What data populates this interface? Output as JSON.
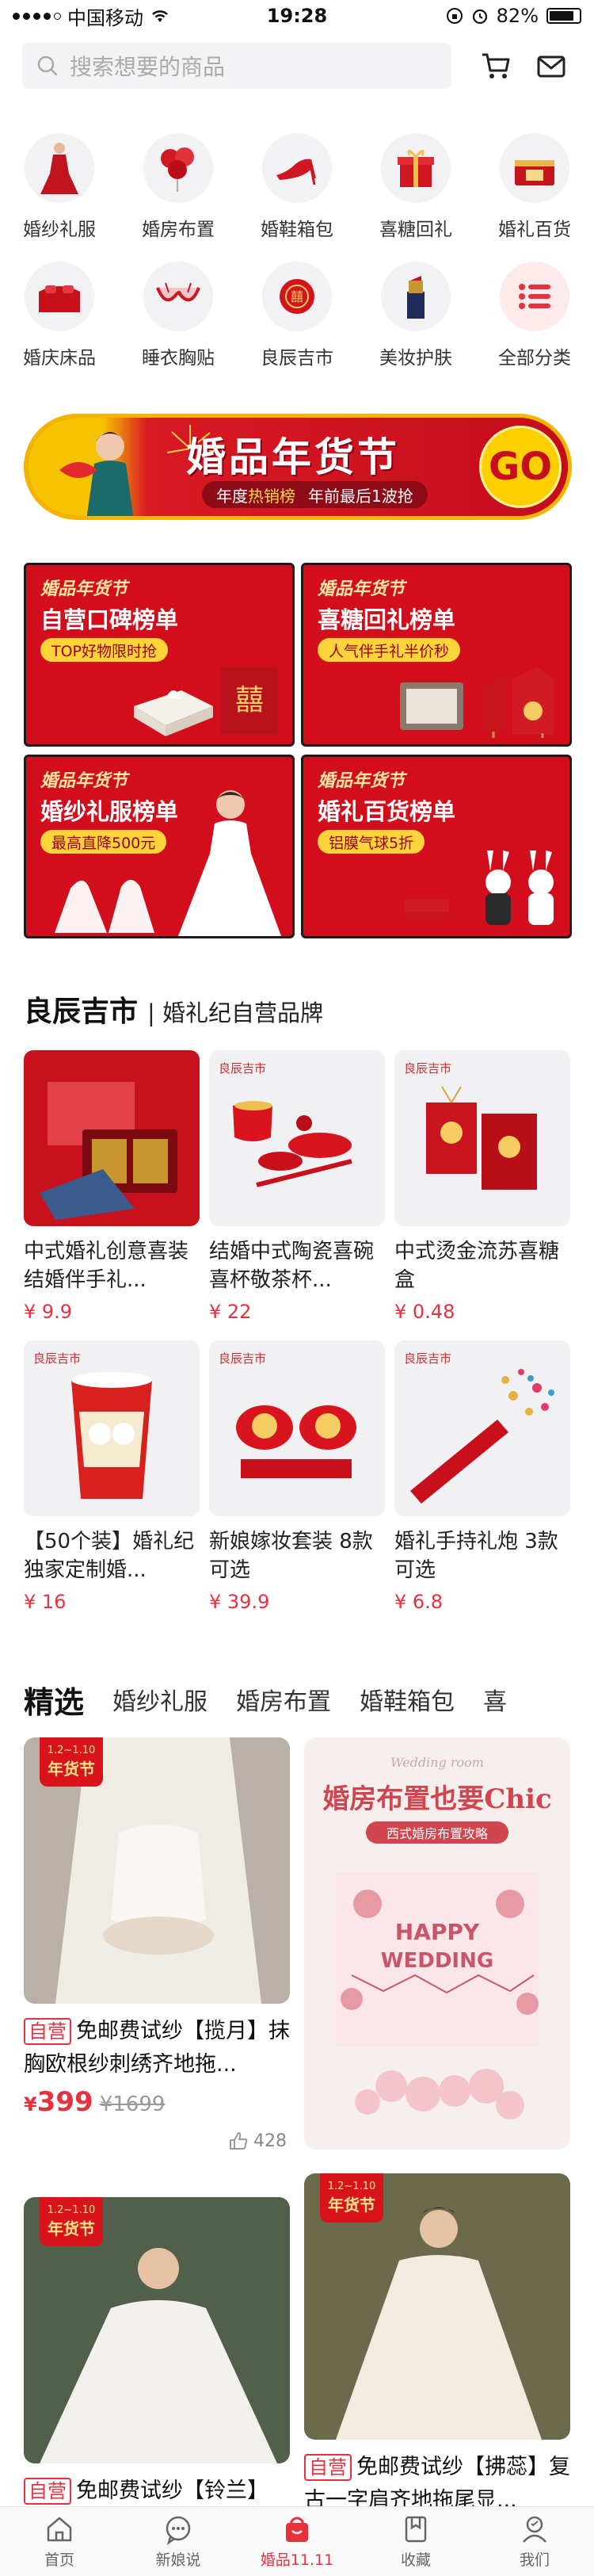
{
  "status_bar": {
    "carrier": "中国移动",
    "time": "19:28",
    "battery": "82%",
    "battery_level": 0.82
  },
  "search": {
    "placeholder": "搜索想要的商品"
  },
  "categories": [
    {
      "label": "婚纱礼服",
      "icon": "dress-icon"
    },
    {
      "label": "婚房布置",
      "icon": "balloon-icon"
    },
    {
      "label": "婚鞋箱包",
      "icon": "heels-icon"
    },
    {
      "label": "喜糖回礼",
      "icon": "gift-box-icon"
    },
    {
      "label": "婚礼百货",
      "icon": "hamper-icon"
    },
    {
      "label": "婚庆床品",
      "icon": "bedding-icon"
    },
    {
      "label": "睡衣胸贴",
      "icon": "lingerie-icon"
    },
    {
      "label": "良辰吉市",
      "icon": "fan-icon"
    },
    {
      "label": "美妆护肤",
      "icon": "lipstick-icon"
    },
    {
      "label": "全部分类",
      "icon": "list-icon"
    }
  ],
  "banner": {
    "title": "婚品年货节",
    "sub_hot_prefix": "年度",
    "sub_hot": "热销榜",
    "sub_right": "年前最后1波抢",
    "go": "GO"
  },
  "rankings": [
    {
      "tag": "婚品年货节",
      "title": "自营口碑榜单",
      "pill": "TOP好物限时抢"
    },
    {
      "tag": "婚品年货节",
      "title": "喜糖回礼榜单",
      "pill": "人气伴手礼半价秒"
    },
    {
      "tag": "婚品年货节",
      "title": "婚纱礼服榜单",
      "pill": "最高直降500元"
    },
    {
      "tag": "婚品年货节",
      "title": "婚礼百货榜单",
      "pill": "铝膜气球5折"
    }
  ],
  "section": {
    "title": "良辰吉市",
    "subtitle": "婚礼纪自营品牌"
  },
  "brand_products": [
    {
      "name": "中式婚礼创意喜装结婚伴手礼...",
      "price": "¥ 9.9",
      "logo": ""
    },
    {
      "name": "结婚中式陶瓷喜碗喜杯敬茶杯...",
      "price": "¥ 22",
      "logo": "良辰吉市"
    },
    {
      "name": "中式烫金流苏喜糖盒",
      "price": "¥ 0.48",
      "logo": "良辰吉市"
    },
    {
      "name": "【50个装】婚礼纪独家定制婚...",
      "price": "¥ 16",
      "logo": "良辰吉市"
    },
    {
      "name": "新娘嫁妆套装 8款可选",
      "price": "¥ 39.9",
      "logo": "良辰吉市"
    },
    {
      "name": "婚礼手持礼炮 3款可选",
      "price": "¥ 6.8",
      "logo": "良辰吉市"
    }
  ],
  "tabs": [
    "精选",
    "婚纱礼服",
    "婚房布置",
    "婚鞋箱包",
    "喜"
  ],
  "feed": {
    "p1": {
      "ribbon_date": "1.2~1.10",
      "ribbon_text": "年货节",
      "badge": "自营",
      "title": "免邮费试纱【揽月】抹胸欧根纱刺绣齐地拖...",
      "price": "399",
      "orig": "¥1699",
      "likes": "428"
    },
    "ad": {
      "title": "婚房布置也要Chic",
      "subtitle": "西式婚房布置攻略",
      "script_top": "Wedding room",
      "balloon": "HAPPY WEDDING"
    },
    "p2": {
      "ribbon_date": "1.2~1.10",
      "ribbon_text": "年货节",
      "badge": "自营",
      "title": "免邮费试纱【铃兰】"
    },
    "p3": {
      "ribbon_date": "1.2~1.10",
      "ribbon_text": "年货节",
      "badge": "自营",
      "title": "免邮费试纱【拂蕊】复古一字肩齐地拖尾显..."
    }
  },
  "tabbar": [
    {
      "label": "首页",
      "icon": "home-icon"
    },
    {
      "label": "新娘说",
      "icon": "chat-icon"
    },
    {
      "label": "婚品11.11",
      "icon": "bag-icon",
      "active": true
    },
    {
      "label": "收藏",
      "icon": "bookmark-icon"
    },
    {
      "label": "我们",
      "icon": "couple-icon"
    }
  ],
  "colors": {
    "accent": "#e8313e",
    "banner_red": "#d61020",
    "banner_gold": "#f5b400"
  }
}
